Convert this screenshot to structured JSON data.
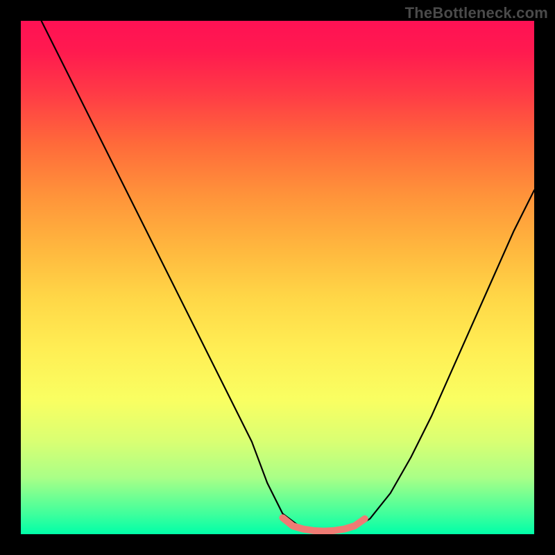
{
  "watermark": {
    "text": "TheBottleneck.com"
  },
  "chart_data": {
    "type": "line",
    "title": "",
    "xlabel": "",
    "ylabel": "",
    "xlim": [
      0,
      100
    ],
    "ylim": [
      0,
      100
    ],
    "grid": false,
    "legend": false,
    "series": [
      {
        "name": "bottleneck-curve",
        "color": "#000000",
        "x": [
          4,
          10,
          15,
          20,
          25,
          30,
          35,
          40,
          45,
          48,
          51,
          55,
          58,
          60,
          63,
          65,
          68,
          72,
          76,
          80,
          84,
          88,
          92,
          96,
          100
        ],
        "y": [
          100,
          88,
          78,
          68,
          58,
          48,
          38,
          28,
          18,
          10,
          4,
          1,
          0.5,
          0.5,
          0.8,
          1.2,
          3,
          8,
          15,
          23,
          32,
          41,
          50,
          59,
          67
        ]
      },
      {
        "name": "optimal-zone-marker",
        "color": "#ef7b74",
        "x": [
          51,
          53,
          55,
          57,
          59,
          61,
          63,
          65,
          67
        ],
        "y": [
          3.2,
          1.6,
          1.0,
          0.7,
          0.6,
          0.7,
          1.0,
          1.6,
          3.0
        ]
      }
    ],
    "gradient_background": {
      "direction": "vertical",
      "stops": [
        {
          "pos": 0.0,
          "color": "#ff1154"
        },
        {
          "pos": 0.24,
          "color": "#ff6a3a"
        },
        {
          "pos": 0.54,
          "color": "#ffd747"
        },
        {
          "pos": 0.82,
          "color": "#d9ff73"
        },
        {
          "pos": 1.0,
          "color": "#00ffa8"
        }
      ]
    }
  }
}
